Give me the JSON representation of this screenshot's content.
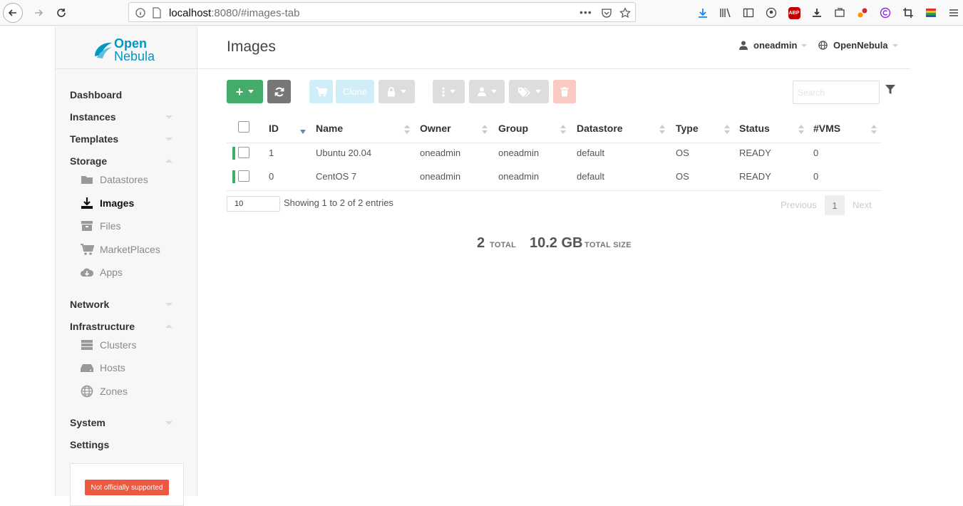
{
  "browser": {
    "url_host": "localhost",
    "url_rest": ":8080/#images-tab",
    "page_actions": "•••"
  },
  "sidebar": {
    "logo_line1": "Open",
    "logo_line2": "Nebula",
    "menu": [
      {
        "label": "Dashboard"
      },
      {
        "label": "Instances"
      },
      {
        "label": "Templates"
      },
      {
        "label": "Storage"
      },
      {
        "label": "Network"
      },
      {
        "label": "Infrastructure"
      },
      {
        "label": "System"
      },
      {
        "label": "Settings"
      }
    ],
    "storage_items": [
      {
        "label": "Datastores",
        "icon": "folder-icon"
      },
      {
        "label": "Images",
        "icon": "download-icon"
      },
      {
        "label": "Files",
        "icon": "archive-icon"
      },
      {
        "label": "MarketPlaces",
        "icon": "cart-icon"
      },
      {
        "label": "Apps",
        "icon": "cloud-download-icon"
      }
    ],
    "infra_items": [
      {
        "label": "Clusters",
        "icon": "server-icon"
      },
      {
        "label": "Hosts",
        "icon": "hdd-icon"
      },
      {
        "label": "Zones",
        "icon": "globe-icon"
      }
    ],
    "support_badge": "Not officially supported"
  },
  "header": {
    "title": "Images",
    "user": "oneadmin",
    "zone": "OpenNebula"
  },
  "toolbar": {
    "create_label": "+",
    "clone_label": "Clone",
    "search_placeholder": "Search"
  },
  "table": {
    "columns": [
      "ID",
      "Name",
      "Owner",
      "Group",
      "Datastore",
      "Type",
      "Status",
      "#VMS"
    ],
    "rows": [
      {
        "id": "1",
        "name": "Ubuntu 20.04",
        "owner": "oneadmin",
        "group": "oneadmin",
        "datastore": "default",
        "type": "OS",
        "status": "READY",
        "vms": "0"
      },
      {
        "id": "0",
        "name": "CentOS 7",
        "owner": "oneadmin",
        "group": "oneadmin",
        "datastore": "default",
        "type": "OS",
        "status": "READY",
        "vms": "0"
      }
    ],
    "status_color": "#43ac6a"
  },
  "footer": {
    "page_length": "10",
    "info": "Showing 1 to 2 of 2 entries",
    "previous": "Previous",
    "current_page": "1",
    "next": "Next"
  },
  "summary": {
    "total_value": "2",
    "total_label": "TOTAL",
    "size_value": "10.2 GB",
    "size_label": "TOTAL SIZE"
  },
  "colors": {
    "accent": "#43ac6a",
    "brand": "#0098c3",
    "danger": "#ec5840"
  }
}
